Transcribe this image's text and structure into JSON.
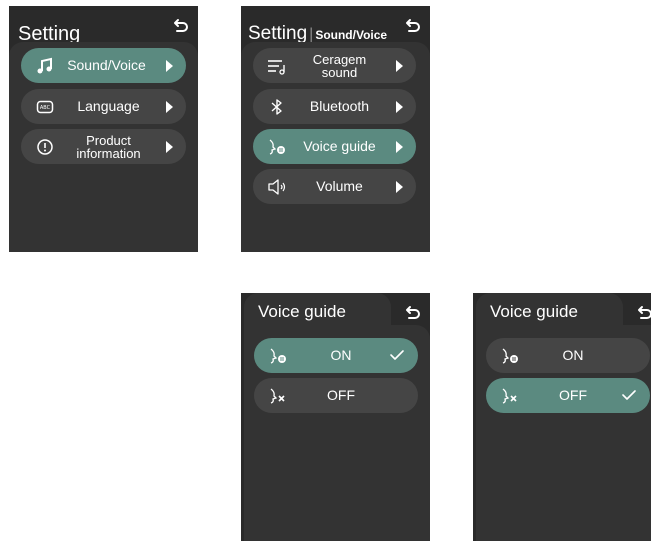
{
  "screen1": {
    "title": "Setting",
    "items": [
      {
        "label": "Sound/Voice",
        "icon": "music-note-icon",
        "active": true
      },
      {
        "label": "Language",
        "icon": "abc-keyboard-icon",
        "active": false
      },
      {
        "label": "Product information",
        "line1": "Product",
        "line2": "information",
        "icon": "info-circle-icon",
        "active": false
      }
    ]
  },
  "screen2": {
    "title": "Setting",
    "separator": "|",
    "subtitle": "Sound/Voice",
    "items": [
      {
        "line1": "Ceragem",
        "line2": "sound",
        "icon": "music-list-icon",
        "active": false
      },
      {
        "label": "Bluetooth",
        "icon": "bluetooth-icon",
        "active": false
      },
      {
        "label": "Voice guide",
        "icon": "voice-guide-icon",
        "active": true
      },
      {
        "label": "Volume",
        "icon": "speaker-icon",
        "active": false
      }
    ]
  },
  "screen3": {
    "title": "Voice guide",
    "options": [
      {
        "label": "ON",
        "icon": "voice-on-icon",
        "selected": true
      },
      {
        "label": "OFF",
        "icon": "voice-off-icon",
        "selected": false
      }
    ]
  },
  "screen4": {
    "title": "Voice guide",
    "options": [
      {
        "label": "ON",
        "icon": "voice-on-icon",
        "selected": false
      },
      {
        "label": "OFF",
        "icon": "voice-off-icon",
        "selected": true
      }
    ]
  },
  "colors": {
    "background": "#2a2a2a",
    "button": "#454545",
    "active": "#5b8a80",
    "text": "#ffffff"
  }
}
